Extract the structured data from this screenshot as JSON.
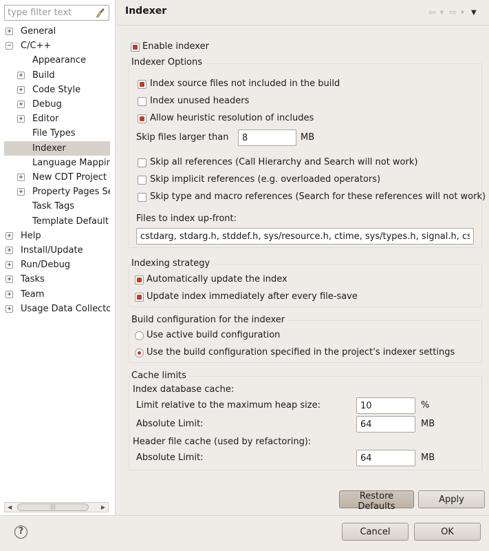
{
  "filter": {
    "placeholder": "type filter text"
  },
  "tree": {
    "items": [
      {
        "label": "General",
        "expander": "+"
      },
      {
        "label": "C/C++",
        "expander": "−"
      },
      {
        "label": "Appearance",
        "expander": ""
      },
      {
        "label": "Build",
        "expander": "+"
      },
      {
        "label": "Code Style",
        "expander": "+"
      },
      {
        "label": "Debug",
        "expander": "+"
      },
      {
        "label": "Editor",
        "expander": "+"
      },
      {
        "label": "File Types",
        "expander": ""
      },
      {
        "label": "Indexer",
        "expander": ""
      },
      {
        "label": "Language Mapping",
        "expander": ""
      },
      {
        "label": "New CDT Project W",
        "expander": "+"
      },
      {
        "label": "Property Pages Set",
        "expander": "+"
      },
      {
        "label": "Task Tags",
        "expander": ""
      },
      {
        "label": "Template Default V",
        "expander": ""
      },
      {
        "label": "Help",
        "expander": "+"
      },
      {
        "label": "Install/Update",
        "expander": "+"
      },
      {
        "label": "Run/Debug",
        "expander": "+"
      },
      {
        "label": "Tasks",
        "expander": "+"
      },
      {
        "label": "Team",
        "expander": "+"
      },
      {
        "label": "Usage Data Collector",
        "expander": "+"
      }
    ],
    "selected": "Indexer",
    "scroll_thumb_glyph": "|||"
  },
  "header": {
    "title": "Indexer",
    "nav": {
      "back": "⇦",
      "back_menu": "▾",
      "forward": "⇨",
      "forward_menu": "▾",
      "view_menu": "▼"
    }
  },
  "indexer": {
    "enable_label": "Enable indexer",
    "enable_checked": true,
    "options": {
      "title": "Indexer Options",
      "index_source_label": "Index source files not included in the build",
      "index_source_checked": true,
      "index_unused_label": "Index unused headers",
      "index_unused_checked": false,
      "heuristic_label": "Allow heuristic resolution of includes",
      "heuristic_checked": true,
      "skip_larger_label": "Skip files larger than",
      "skip_larger_value": "8",
      "skip_larger_unit": "MB",
      "skip_all_label": "Skip all references (Call Hierarchy and Search will not work)",
      "skip_all_checked": false,
      "skip_implicit_label": "Skip implicit references (e.g. overloaded operators)",
      "skip_implicit_checked": false,
      "skip_type_label": "Skip type and macro references (Search for these references will not work)",
      "skip_type_checked": false,
      "upfront_label": "Files to index up-front:",
      "upfront_value": "cstdarg, stdarg.h, stddef.h, sys/resource.h, ctime, sys/types.h, signal.h, cstdio"
    },
    "strategy": {
      "title": "Indexing strategy",
      "auto_update_label": "Automatically update the index",
      "auto_update_checked": true,
      "immediate_label": "Update index immediately after every file-save",
      "immediate_checked": true
    },
    "build_config": {
      "title": "Build configuration for the indexer",
      "active_label": "Use active build configuration",
      "specified_label": "Use the build configuration specified in the project's indexer settings",
      "selected": "specified"
    },
    "cache": {
      "title": "Cache limits",
      "db_cache_label": "Index database cache:",
      "relative_label": "Limit relative to the maximum heap size:",
      "relative_value": "10",
      "relative_unit": "%",
      "absolute_label": "Absolute Limit:",
      "absolute_value": "64",
      "absolute_unit": "MB",
      "header_cache_label": "Header file cache (used by refactoring):",
      "header_absolute_label": "Absolute Limit:",
      "header_absolute_value": "64",
      "header_absolute_unit": "MB"
    }
  },
  "buttons": {
    "restore_defaults": "Restore Defaults",
    "apply": "Apply",
    "cancel": "Cancel",
    "ok": "OK"
  },
  "help_glyph": "?",
  "colors": {
    "check_accent": "#c23a2b",
    "selected_row": "#d6d1ca",
    "window_bg": "#efebe7"
  }
}
